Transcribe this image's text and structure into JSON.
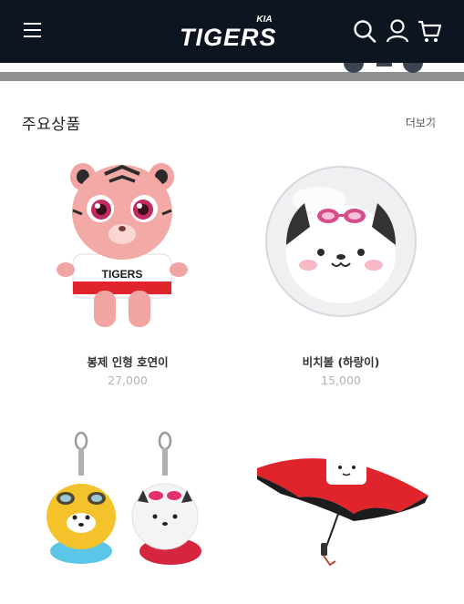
{
  "header": {
    "logo_text": "TIGERS",
    "logo_brand": "KIA"
  },
  "section": {
    "title": "주요상품",
    "more_label": "더보기"
  },
  "products": [
    {
      "name": "봉제 인형 호연이",
      "price": "27,000",
      "image_icon": "pink-tiger-plush-image"
    },
    {
      "name": "비치볼 (하랑이)",
      "price": "15,000",
      "image_icon": "beach-ball-image"
    },
    {
      "name": "",
      "price": "",
      "image_icon": "tiger-keychains-image"
    },
    {
      "name": "",
      "price": "",
      "image_icon": "red-umbrella-image"
    }
  ],
  "colors": {
    "header_bg": "#0d1620",
    "price": "#b3b3b3",
    "accent_red": "#e0242c"
  }
}
